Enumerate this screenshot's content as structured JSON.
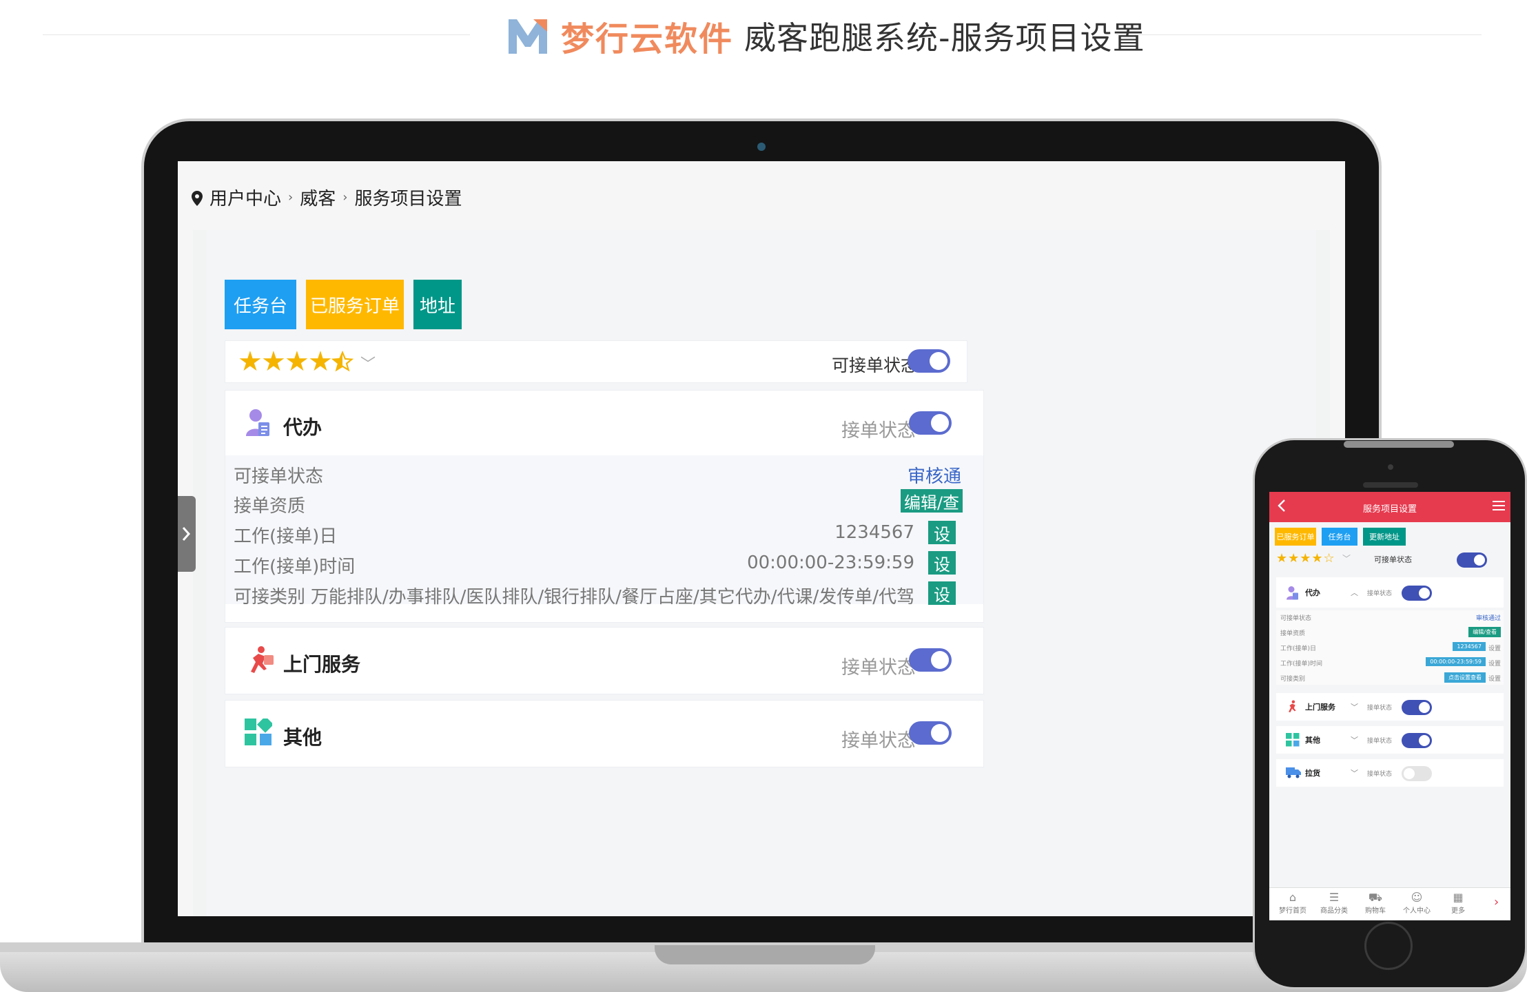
{
  "header": {
    "brand_name": "梦行云软件",
    "page_title": "威客跑腿系统-服务项目设置"
  },
  "breadcrumb": {
    "items": [
      "用户中心",
      "威客",
      "服务项目设置"
    ],
    "separator": "›"
  },
  "desktop": {
    "tabs": [
      {
        "label": "任务台",
        "color": "#1e9ff2"
      },
      {
        "label": "已服务订单",
        "color": "#ffb800"
      },
      {
        "label": "地址",
        "color": "#009688"
      }
    ],
    "rating": {
      "stars": 4.5,
      "max": 5
    },
    "accept_status_label": "可接单状态",
    "sections": [
      {
        "title": "代办",
        "status_label": "接单状态",
        "icon": "person-document-icon",
        "rows": [
          {
            "label": "可接单状态",
            "value": "",
            "action": "审核通"
          },
          {
            "label": "接单资质",
            "value": "",
            "action": "编辑/查"
          },
          {
            "label": "工作(接单)日",
            "value": "1234567",
            "action": "设"
          },
          {
            "label": "工作(接单)时间",
            "value": "00:00:00-23:59:59",
            "action": "设"
          },
          {
            "label": "可接类别",
            "value": "万能排队/办事排队/医队排队/银行排队/餐厅占座/其它代办/代课/发传单/代驾",
            "action": "设"
          }
        ]
      },
      {
        "title": "上门服务",
        "status_label": "接单状态",
        "icon": "runner-icon"
      },
      {
        "title": "其他",
        "status_label": "接单状态",
        "icon": "apps-grid-icon"
      }
    ]
  },
  "mobile": {
    "title": "服务项目设置",
    "tabs": [
      {
        "label": "已服务订单",
        "color": "#ffb800"
      },
      {
        "label": "任务台",
        "color": "#1e9ff2"
      },
      {
        "label": "更新地址",
        "color": "#009688"
      }
    ],
    "accept_status_label": "可接单状态",
    "section_status_label": "接单状态",
    "daiban": {
      "title": "代办",
      "rows": [
        {
          "label": "可接单状态",
          "value": "审核通过"
        },
        {
          "label": "接单资质",
          "value": "编辑/查看"
        },
        {
          "label": "工作(接单)日",
          "value": "1234567",
          "action": "设置"
        },
        {
          "label": "工作(接单)时间",
          "value": "00:00:00-23:59:59",
          "action": "设置"
        },
        {
          "label": "可接类别",
          "value": "点击设置查看",
          "action": "设置"
        }
      ]
    },
    "sections": [
      {
        "title": "上门服务",
        "enabled": true
      },
      {
        "title": "其他",
        "enabled": true
      },
      {
        "title": "拉货",
        "enabled": false
      }
    ],
    "nav": [
      "梦行首页",
      "商品分类",
      "购物车",
      "个人中心",
      "更多"
    ]
  }
}
